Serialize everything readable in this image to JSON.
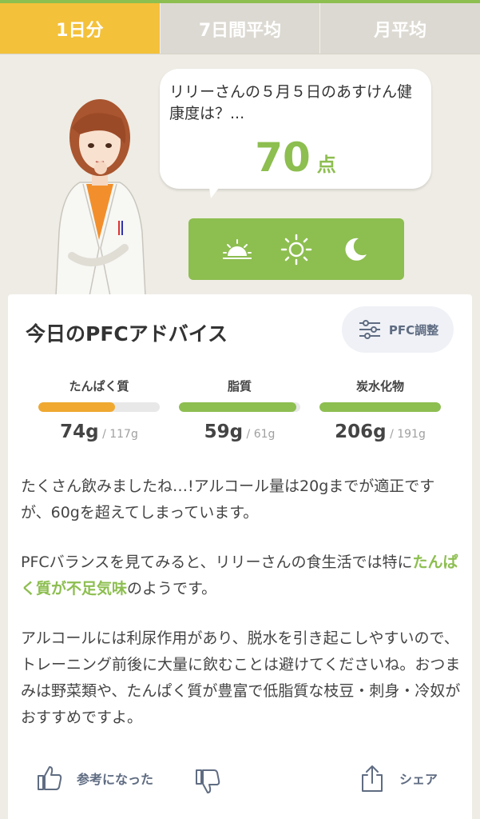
{
  "tabs": [
    {
      "label": "1日分",
      "active": true
    },
    {
      "label": "7日間平均",
      "active": false
    },
    {
      "label": "月平均",
      "active": false
    }
  ],
  "bubble": {
    "question": "リリーさんの５月５日のあすけん健康度は？...",
    "score": "70",
    "score_unit": "点"
  },
  "time_icons": [
    "sunrise-icon",
    "sun-icon",
    "moon-icon"
  ],
  "card": {
    "title": "今日のPFCアドバイス",
    "adjust_label": "PFC調整",
    "nutrients": [
      {
        "label": "たんぱく質",
        "value": "74g",
        "target": "/ 117g",
        "fraction": 0.63,
        "color": "#f0a830"
      },
      {
        "label": "脂質",
        "value": "59g",
        "target": "/ 61g",
        "fraction": 0.97,
        "color": "#8dbe50"
      },
      {
        "label": "炭水化物",
        "value": "206g",
        "target": "/ 191g",
        "fraction": 1.0,
        "color": "#8dbe50"
      }
    ],
    "para1": "たくさん飲みましたね…!アルコール量は20gまでが適正ですが、60gを超えてしまっています。",
    "para2_pre": "PFCバランスを見てみると、リリーさんの食生活では特に",
    "para2_highlight": "たんぱく質が不足気味",
    "para2_post": "のようです。",
    "para3": "アルコールには利尿作用があり、脱水を引き起こしやすいので、トレーニング前後に大量に飲むことは避けてくださいね。おつまみは野菜類や、たんぱく質が豊富で低脂質な枝豆・刺身・冷奴がおすすめですよ。",
    "helpful_label": "参考になった",
    "share_label": "シェア"
  },
  "colors": {
    "accent_green": "#8dbe50",
    "tab_active": "#f4c13a",
    "protein_bar": "#f0a830"
  }
}
